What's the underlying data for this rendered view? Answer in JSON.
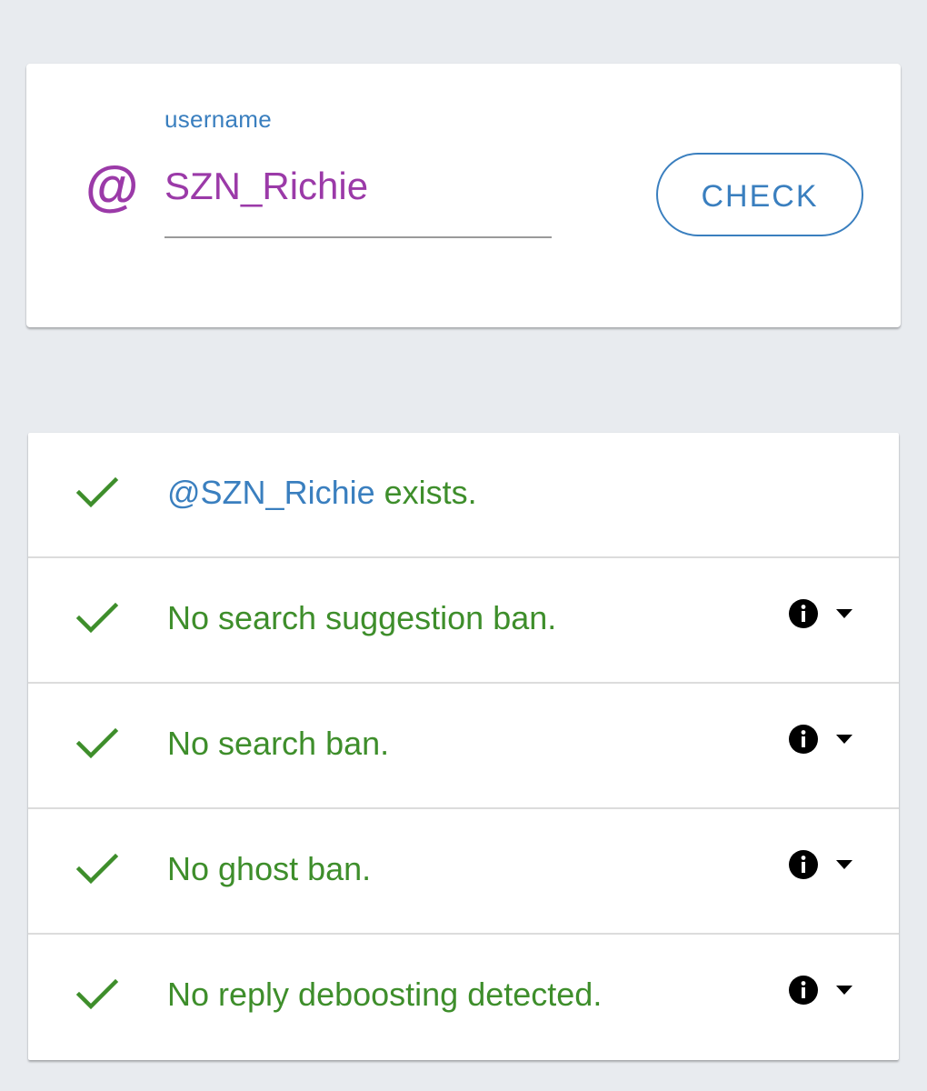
{
  "lookup": {
    "field_label": "username",
    "at_symbol": "@",
    "username_value": "SZN_Richie",
    "check_button_label": "CHECK"
  },
  "results": {
    "exists": {
      "handle": "@SZN_Richie",
      "suffix": " exists."
    },
    "items": [
      {
        "label": "No search suggestion ban.",
        "status": "pass"
      },
      {
        "label": "No search ban.",
        "status": "pass"
      },
      {
        "label": "No ghost ban.",
        "status": "pass"
      },
      {
        "label": "No reply deboosting detected.",
        "status": "pass"
      }
    ]
  },
  "colors": {
    "accent_blue": "#3a7fbf",
    "username_purple": "#9b3aa8",
    "success_green": "#3e8e2b",
    "background": "#e8ebef"
  },
  "icons": {
    "status": "checkmark-icon",
    "info": "info-icon",
    "expand": "caret-down-icon"
  }
}
